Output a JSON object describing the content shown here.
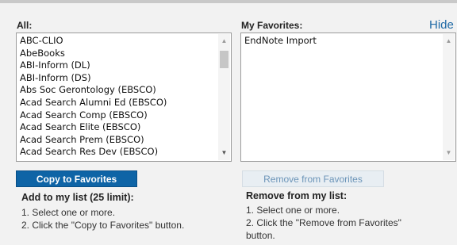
{
  "all_panel": {
    "label": "All:",
    "items": [
      "ABC-CLIO",
      "AbeBooks",
      "ABI-Inform (DL)",
      "ABI-Inform (DS)",
      "Abs Soc Gerontology (EBSCO)",
      "Acad Search Alumni Ed (EBSCO)",
      "Acad Search Comp (EBSCO)",
      "Acad Search Elite (EBSCO)",
      "Acad Search Prem (EBSCO)",
      "Acad Search Res Dev (EBSCO)"
    ],
    "copy_button": "Copy to Favorites",
    "help_title": "Add to my list (25 limit):",
    "help_steps": [
      "1. Select one or more.",
      "2. Click the \"Copy to Favorites\" button."
    ]
  },
  "favorites_panel": {
    "label": "My Favorites:",
    "hide_link": "Hide",
    "items": [
      "EndNote Import"
    ],
    "remove_button": "Remove from Favorites",
    "help_title": "Remove from my list:",
    "help_steps": [
      "1. Select one or more.",
      "2. Click the \"Remove from Favorites\"",
      "button."
    ]
  },
  "icons": {
    "scroll_up": "scroll-up-arrow-icon",
    "scroll_down": "scroll-down-arrow-icon"
  }
}
